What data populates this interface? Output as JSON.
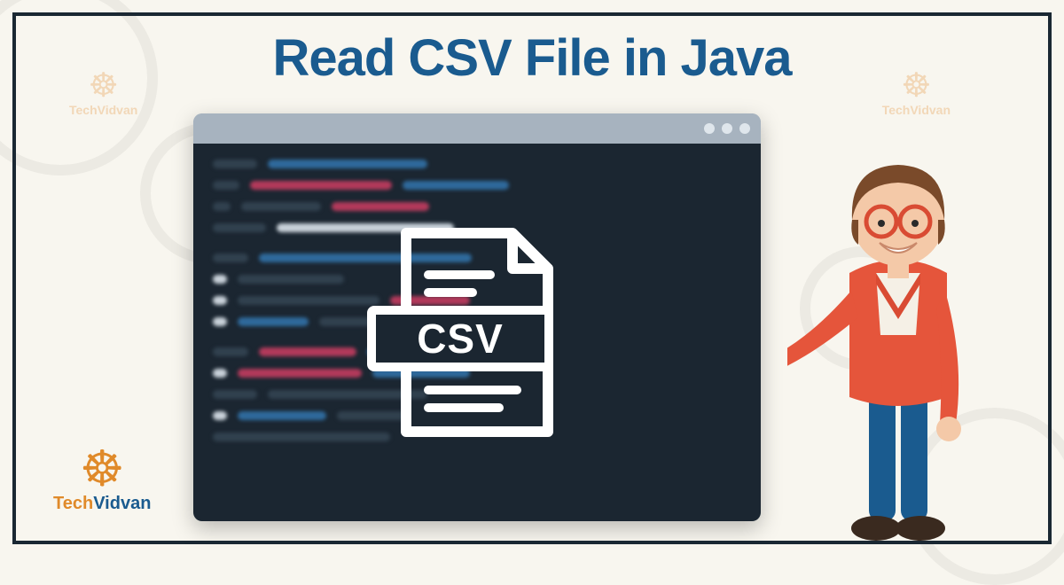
{
  "title": "Read CSV File in Java",
  "csv_label": "CSV",
  "brand": {
    "tech": "Tech",
    "vidvan": "Vidvan"
  },
  "watermark": "TechVidvan",
  "colors": {
    "title": "#1a5b8f",
    "frame": "#1a2833",
    "bg": "#f8f6ef",
    "editor_bg": "#1b2631",
    "editor_chrome": "#a7b3bf",
    "accent_orange": "#e08a2a"
  }
}
